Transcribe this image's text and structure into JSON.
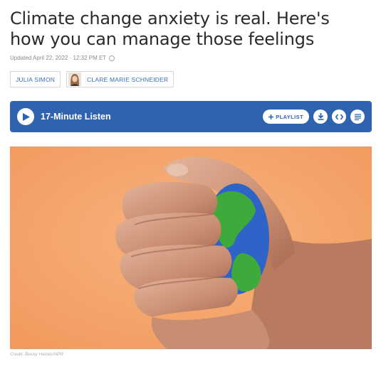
{
  "article": {
    "headline": "Climate change anxiety is real. Here's how you can manage those feelings",
    "dateline": "Updated April 22, 2022 · 12:32 PM ET"
  },
  "bylines": [
    {
      "name": "JULIA SIMON",
      "has_avatar": false
    },
    {
      "name": "CLARE MARIE SCHNEIDER",
      "has_avatar": true
    }
  ],
  "player": {
    "listen_label": "17-Minute Listen",
    "playlist_label": "PLAYLIST",
    "icons": [
      "play-icon",
      "plus-icon",
      "download-icon",
      "embed-icon",
      "transcript-icon"
    ],
    "background_color": "#2f63b0"
  },
  "image": {
    "description_icon": "hand-squeezing-globe-stress-ball",
    "background_color": "#f5a76c",
    "credit": "Credit: Becky Harlan/NPR"
  }
}
